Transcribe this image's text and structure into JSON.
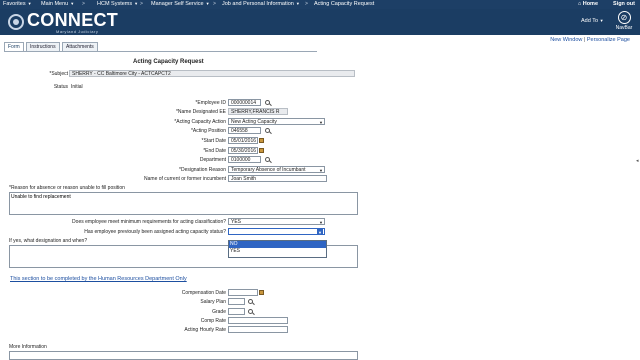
{
  "topbar": {
    "favorites": "Favorites",
    "main_menu": "Main Menu",
    "breadcrumbs": [
      "HCM Systems",
      "Manager Self Service",
      "Job and Personal Information",
      "Acting Capacity Request"
    ],
    "home": "Home",
    "sign_out": "Sign out"
  },
  "header": {
    "logo": "CONNECT",
    "logo_sub": "Maryland Judiciary",
    "add_to": "Add To",
    "navbar": "NavBar"
  },
  "tabs": [
    "Form",
    "Instructions",
    "Attachments"
  ],
  "links": {
    "new_window": "New Window",
    "personalize": "Personalize Page"
  },
  "form": {
    "title": "Acting Capacity Request",
    "subject_label": "*Subject",
    "subject_value": "SHERRY - CC Baltimore City - ACTCAPCT2",
    "status_label": "Status",
    "status_value": "Initial",
    "employee_id_label": "*Employee ID",
    "employee_id": "000000014",
    "name_label": "*Name Designated EE",
    "name_value": "SHERRY,FRANCIS R",
    "action_label": "*Acting Capacity Action",
    "action_value": "New Acting Capacity",
    "position_label": "*Acting Position",
    "position_value": "046558",
    "start_label": "*Start Date",
    "start_value": "05/01/2016",
    "end_label": "*End Date",
    "end_value": "05/30/2016",
    "dept_label": "Department",
    "dept_value": "0100000",
    "reason_label": "*Designation Reason",
    "reason_value": "Temporary Absence of Incumbant",
    "incumbent_label": "Name of current or former incumbent",
    "incumbent_value": "Joan Smith",
    "absence_label": "*Reason for absence or reason unable to fill position",
    "absence_value": "Unable to find replacement",
    "min_req_label": "Does employee meet minimum requirements for acting classification?",
    "min_req_value": "YES",
    "prev_label": "Has employee previously been assigned acting capacity status?",
    "prev_value": "",
    "prev_options": [
      "NO",
      "YES"
    ],
    "if_yes_label": "If yes, what designation and when?"
  },
  "hr": {
    "link": "This section to be completed by the Human Resources Department Only",
    "comp_date": "Compensation Date",
    "salary_plan": "Salary Plan",
    "grade": "Grade",
    "comp_rate": "Comp Rate",
    "hourly_rate": "Acting Hourly Rate",
    "more_info": "More Information"
  }
}
